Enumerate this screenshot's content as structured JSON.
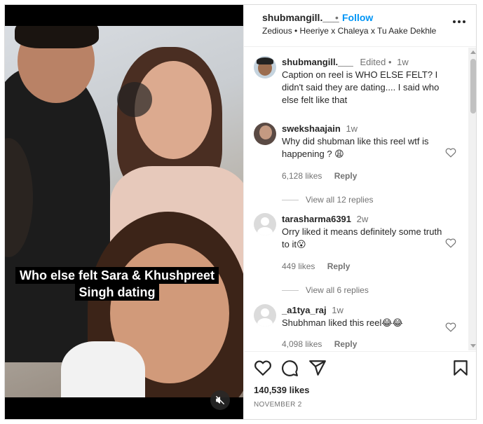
{
  "header": {
    "username": "shubmangill.___",
    "separator": "•",
    "follow_label": "Follow",
    "audio": "Zedious • Heeriye x Chaleya x Tu Aake Dekhle",
    "more_icon": "more-horizontal-icon"
  },
  "media": {
    "overlay_line1": "Who else felt Sara & Khushpreet",
    "overlay_line2": "Singh dating",
    "mute_icon": "muted-speaker-icon"
  },
  "caption": {
    "username": "shubmangill.___",
    "edited": "Edited •",
    "time": "1w",
    "text": "Caption on reel is WHO ELSE FELT? I didn't said they are dating.... I said who else felt like that"
  },
  "comments": [
    {
      "username": "swekshaajain",
      "time": "1w",
      "text": "Why did shubman like this reel wtf is happening ? 😩",
      "likes": "6,128 likes",
      "reply_label": "Reply",
      "view_replies": "View all 12 replies"
    },
    {
      "username": "tarasharma6391",
      "time": "2w",
      "text": "Orry liked it means definitely some truth to it😮",
      "likes": "449 likes",
      "reply_label": "Reply",
      "view_replies": "View all 6 replies"
    },
    {
      "username": "_a1tya_raj",
      "time": "1w",
      "text": "Shubhman liked this reel😂😂",
      "likes": "4,098 likes",
      "reply_label": "Reply"
    }
  ],
  "actions": {
    "like_icon": "heart-icon",
    "comment_icon": "comment-icon",
    "share_icon": "share-icon",
    "save_icon": "bookmark-icon",
    "likes_count": "140,539 likes",
    "date": "NOVEMBER 2"
  },
  "colors": {
    "accent": "#0095f6",
    "text": "#262626",
    "muted": "#737373",
    "border": "#dbdbdb"
  }
}
